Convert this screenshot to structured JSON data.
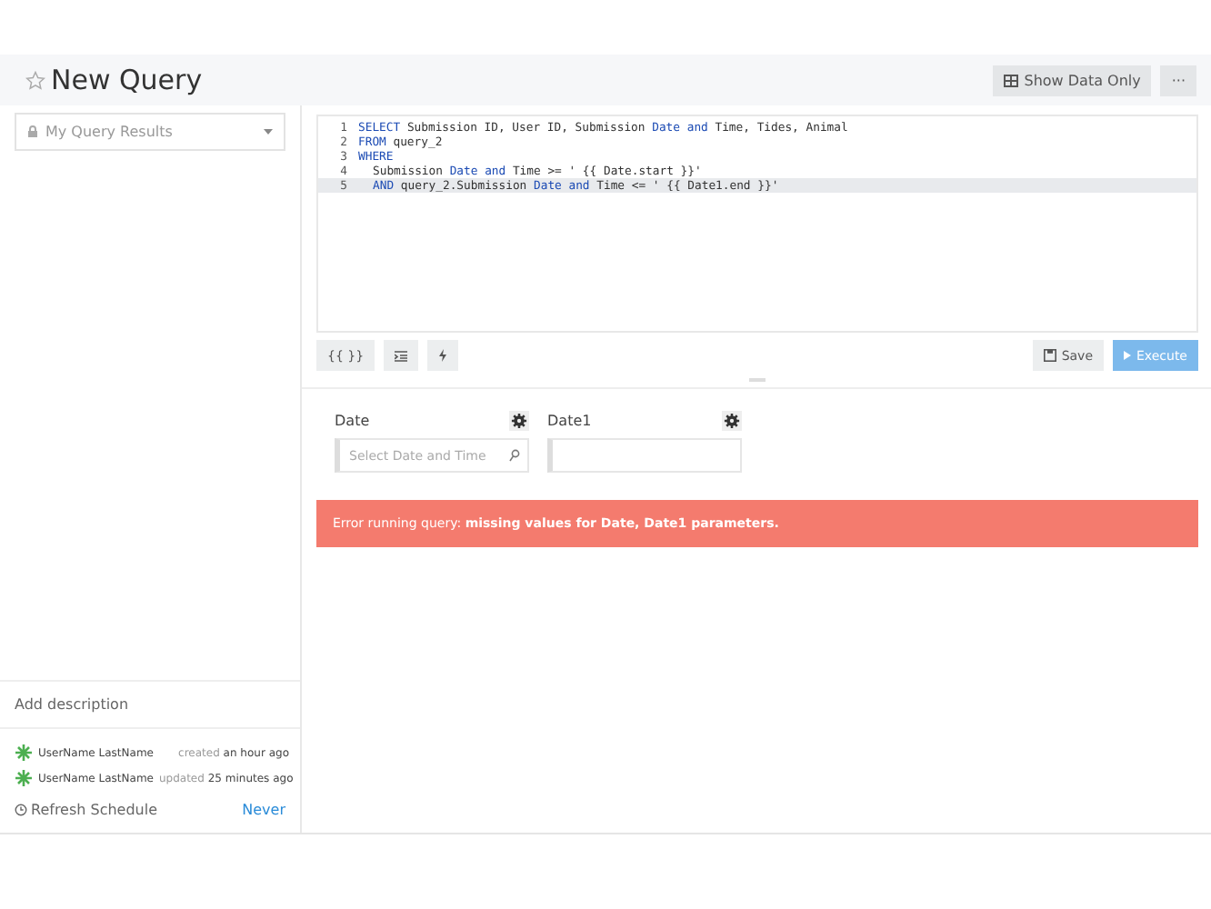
{
  "header": {
    "title": "New Query",
    "starred": false,
    "buttons": [
      "Show Data Only",
      "···"
    ]
  },
  "sidebar": {
    "dropdown": "My Query Results",
    "description": "Add description",
    "activity": [
      {
        "user": "UserName LastName",
        "action": "created",
        "when": "an hour ago"
      },
      {
        "user": "UserName LastName",
        "action": "updated",
        "when": "25 minutes ago"
      }
    ],
    "refresh": {
      "label": "Refresh Schedule",
      "value": "Never"
    }
  },
  "editor": {
    "lines": [
      {
        "number": "1",
        "selected": false,
        "indent": false,
        "tokens": [
          {
            "kind": "kw",
            "text": "SELECT"
          },
          {
            "kind": "plain",
            "text": " Submission ID, User ID, Submission "
          },
          {
            "kind": "kw",
            "text": "Date and"
          },
          {
            "kind": "plain",
            "text": " Time, Tides, Animal"
          }
        ]
      },
      {
        "number": "2",
        "selected": false,
        "indent": false,
        "tokens": [
          {
            "kind": "kw",
            "text": "FROM"
          },
          {
            "kind": "plain",
            "text": " query_2"
          }
        ]
      },
      {
        "number": "3",
        "selected": false,
        "indent": false,
        "tokens": [
          {
            "kind": "kw",
            "text": "WHERE"
          }
        ]
      },
      {
        "number": "4",
        "selected": false,
        "indent": true,
        "tokens": [
          {
            "kind": "plain",
            "text": "Submission "
          },
          {
            "kind": "kw",
            "text": "Date and"
          },
          {
            "kind": "plain",
            "text": " Time >= ' {{ Date.start }}'"
          }
        ]
      },
      {
        "number": "5",
        "selected": true,
        "indent": true,
        "tokens": [
          {
            "kind": "kw",
            "text": "AND"
          },
          {
            "kind": "plain",
            "text": " query_2.Submission "
          },
          {
            "kind": "kw",
            "text": "Date and"
          },
          {
            "kind": "plain",
            "text": " Time <= ' {{ Date1.end }}'"
          }
        ]
      }
    ],
    "toolbar": {
      "params_button": "{{ }}",
      "save": "Save",
      "execute": "Execute"
    }
  },
  "parameters": [
    {
      "label": "Date",
      "placeholder": "Select Date and Time"
    },
    {
      "label": "Date1"
    }
  ],
  "error": {
    "prefix": "Error running query: ",
    "detail": "missing values for Date, Date1 parameters."
  }
}
